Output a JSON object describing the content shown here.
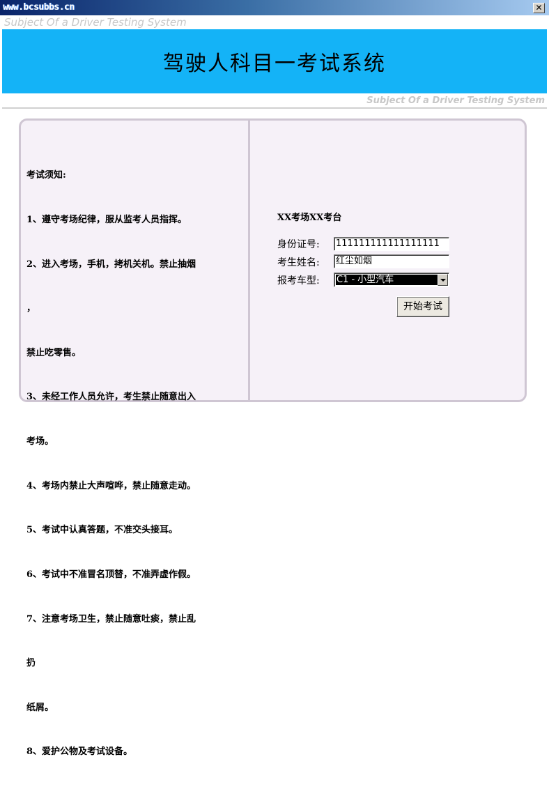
{
  "window": {
    "title": "www.bcsubbs.cn",
    "close_glyph": "✕"
  },
  "header": {
    "subtitle_top": "Subject Of a Driver Testing System",
    "heading": "驾驶人科目一考试系统",
    "subtitle_right": "Subject Of a Driver Testing System",
    "banner_color": "#14b3f7"
  },
  "notice": {
    "lines": [
      "考试须知:",
      "1、遵守考场纪律，服从监考人员指挥。",
      "2、进入考场，手机，拷机关机。禁止抽烟",
      "，",
      "禁止吃零售。",
      "3、未经工作人员允许，考生禁止随意出入",
      "考场。",
      "4、考场内禁止大声喧哗，禁止随意走动。",
      "5、考试中认真答题，不准交头接耳。",
      "6、考试中不准冒名顶替，不准弄虚作假。",
      "7、注意考场卫生，禁止随意吐痰，禁止乱",
      "扔",
      "纸屑。",
      "8、爱护公物及考试设备。"
    ]
  },
  "form": {
    "exam_site": "XX考场XX考台",
    "id_label": "身份证号:",
    "id_value": "111111111111111111",
    "name_label": "考生姓名:",
    "name_value": "红尘如烟",
    "vehicle_label": "报考车型:",
    "vehicle_value": "C1 - 小型汽车",
    "start_button": "开始考试"
  }
}
